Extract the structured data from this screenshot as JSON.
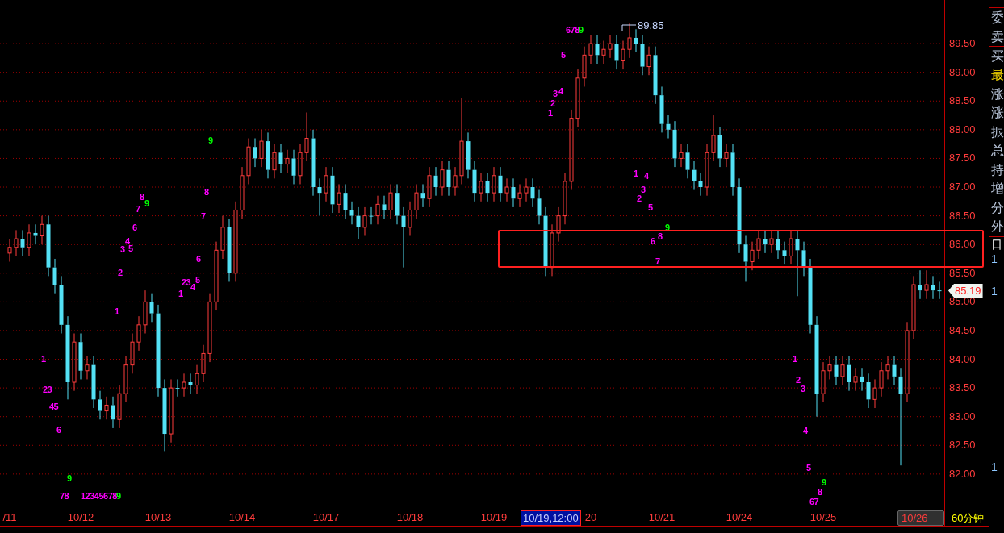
{
  "chart_data": {
    "type": "candlestick",
    "ylim": [
      81.38,
      90.26
    ],
    "grid": true,
    "categories": [
      "/11",
      null,
      null,
      null,
      null,
      null,
      null,
      null,
      null,
      null,
      null,
      "10/12",
      null,
      null,
      null,
      null,
      null,
      null,
      null,
      null,
      null,
      null,
      null,
      "10/13",
      null,
      null,
      null,
      null,
      null,
      null,
      null,
      null,
      null,
      null,
      null,
      null,
      "10/14",
      null,
      null,
      null,
      null,
      null,
      null,
      null,
      null,
      null,
      null,
      null,
      null,
      "10/17",
      null,
      null,
      null,
      null,
      null,
      null,
      null,
      null,
      null,
      null,
      null,
      null,
      "10/18",
      null,
      null,
      null,
      null,
      null,
      null,
      null,
      null,
      null,
      null,
      null,
      null,
      "10/19",
      null,
      null,
      null,
      null,
      null,
      null,
      null,
      null,
      null,
      null,
      null,
      null,
      null,
      null,
      "20",
      null,
      null,
      null,
      null,
      null,
      null,
      null,
      null,
      null,
      null,
      "10/21",
      null,
      null,
      null,
      null,
      null,
      null,
      null,
      null,
      null,
      null,
      null,
      "10/24",
      null,
      null,
      null,
      null,
      null,
      null,
      null,
      null,
      null,
      null,
      null,
      null,
      "10/25",
      null,
      null,
      null,
      null,
      null,
      null,
      null,
      null,
      null,
      null,
      null,
      null,
      null,
      null,
      null,
      null,
      null,
      null
    ],
    "yticks": [
      {
        "value": 89.5,
        "label": "89.50"
      },
      {
        "value": 89,
        "label": "89.00"
      },
      {
        "value": 88.5,
        "label": "88.50"
      },
      {
        "value": 88,
        "label": "88.00"
      },
      {
        "value": 87.5,
        "label": "87.50"
      },
      {
        "value": 87,
        "label": "87.00"
      },
      {
        "value": 86.5,
        "label": "86.50"
      },
      {
        "value": 86,
        "label": "86.00"
      },
      {
        "value": 85.5,
        "label": "85.50"
      },
      {
        "value": 85,
        "label": "85.00"
      },
      {
        "value": 84.5,
        "label": "84.50"
      },
      {
        "value": 84,
        "label": "84.00"
      },
      {
        "value": 83.5,
        "label": "83.50"
      },
      {
        "value": 83,
        "label": "83.00"
      },
      {
        "value": 82.5,
        "label": "82.50"
      },
      {
        "value": 82,
        "label": "82.00"
      }
    ],
    "ohlc": [
      [
        85.85,
        86.1,
        85.7,
        85.95
      ],
      [
        85.95,
        86.25,
        85.8,
        86.1
      ],
      [
        86.1,
        86.25,
        85.8,
        85.95
      ],
      [
        85.95,
        86.35,
        85.8,
        86.2
      ],
      [
        86.2,
        86.35,
        86.0,
        86.15
      ],
      [
        86.15,
        86.5,
        86.0,
        86.35
      ],
      [
        86.35,
        86.5,
        85.45,
        85.6
      ],
      [
        85.6,
        85.75,
        85.15,
        85.3
      ],
      [
        85.3,
        85.45,
        84.45,
        84.6
      ],
      [
        84.6,
        84.75,
        83.3,
        83.6
      ],
      [
        83.6,
        84.45,
        83.45,
        84.3
      ],
      [
        84.3,
        84.45,
        83.65,
        83.8
      ],
      [
        83.8,
        84.05,
        83.65,
        83.9
      ],
      [
        83.9,
        84.05,
        83.15,
        83.3
      ],
      [
        83.3,
        83.45,
        82.95,
        83.1
      ],
      [
        83.1,
        83.35,
        82.95,
        83.2
      ],
      [
        83.2,
        83.35,
        82.8,
        82.95
      ],
      [
        82.95,
        83.55,
        82.8,
        83.4
      ],
      [
        83.4,
        84.05,
        83.25,
        83.9
      ],
      [
        83.9,
        84.45,
        83.75,
        84.3
      ],
      [
        84.3,
        84.75,
        84.15,
        84.6
      ],
      [
        84.6,
        85.2,
        84.45,
        85.0
      ],
      [
        85.0,
        85.15,
        84.65,
        84.8
      ],
      [
        84.8,
        84.95,
        83.35,
        83.5
      ],
      [
        83.5,
        83.65,
        82.4,
        82.7
      ],
      [
        82.7,
        83.65,
        82.55,
        83.5
      ],
      [
        83.5,
        83.65,
        83.35,
        83.5
      ],
      [
        83.5,
        83.75,
        83.35,
        83.6
      ],
      [
        83.6,
        83.75,
        83.4,
        83.55
      ],
      [
        83.55,
        83.9,
        83.4,
        83.75
      ],
      [
        83.75,
        84.25,
        83.6,
        84.1
      ],
      [
        84.1,
        85.15,
        83.95,
        85.0
      ],
      [
        85.0,
        86.05,
        84.85,
        85.9
      ],
      [
        85.9,
        86.5,
        85.75,
        86.3
      ],
      [
        86.3,
        86.45,
        85.35,
        85.5
      ],
      [
        85.5,
        86.75,
        85.35,
        86.6
      ],
      [
        86.6,
        87.35,
        86.45,
        87.2
      ],
      [
        87.2,
        87.85,
        87.05,
        87.7
      ],
      [
        87.7,
        87.85,
        87.35,
        87.5
      ],
      [
        87.5,
        88.0,
        87.35,
        87.8
      ],
      [
        87.8,
        87.95,
        87.15,
        87.3
      ],
      [
        87.3,
        87.75,
        87.15,
        87.6
      ],
      [
        87.6,
        87.75,
        87.25,
        87.4
      ],
      [
        87.4,
        87.65,
        87.25,
        87.5
      ],
      [
        87.5,
        87.65,
        87.05,
        87.2
      ],
      [
        87.2,
        87.75,
        87.05,
        87.6
      ],
      [
        87.6,
        88.3,
        87.45,
        87.85
      ],
      [
        87.85,
        88.0,
        86.85,
        87.0
      ],
      [
        87.0,
        87.15,
        86.5,
        86.9
      ],
      [
        86.9,
        87.35,
        86.75,
        87.2
      ],
      [
        87.2,
        87.35,
        86.55,
        86.7
      ],
      [
        86.7,
        87.05,
        86.55,
        86.9
      ],
      [
        86.9,
        87.05,
        86.45,
        86.6
      ],
      [
        86.6,
        86.75,
        86.35,
        86.5
      ],
      [
        86.5,
        86.65,
        86.1,
        86.3
      ],
      [
        86.3,
        86.65,
        86.15,
        86.5
      ],
      [
        86.5,
        86.65,
        86.35,
        86.5
      ],
      [
        86.5,
        86.85,
        86.35,
        86.7
      ],
      [
        86.7,
        86.85,
        86.45,
        86.6
      ],
      [
        86.6,
        87.05,
        86.45,
        86.9
      ],
      [
        86.9,
        87.05,
        86.35,
        86.5
      ],
      [
        86.5,
        86.65,
        85.6,
        86.3
      ],
      [
        86.3,
        86.75,
        86.15,
        86.6
      ],
      [
        86.6,
        87.05,
        86.45,
        86.9
      ],
      [
        86.9,
        87.05,
        86.65,
        86.8
      ],
      [
        86.8,
        87.35,
        86.65,
        87.2
      ],
      [
        87.2,
        87.35,
        86.85,
        87.0
      ],
      [
        87.0,
        87.45,
        86.85,
        87.3
      ],
      [
        87.3,
        87.45,
        86.85,
        87.0
      ],
      [
        87.0,
        87.35,
        86.85,
        87.2
      ],
      [
        87.2,
        88.55,
        87.05,
        87.8
      ],
      [
        87.8,
        87.95,
        87.15,
        87.3
      ],
      [
        87.3,
        87.45,
        86.75,
        86.9
      ],
      [
        86.9,
        87.25,
        86.75,
        87.1
      ],
      [
        87.1,
        87.25,
        86.75,
        86.9
      ],
      [
        86.9,
        87.35,
        86.75,
        87.2
      ],
      [
        87.2,
        87.35,
        86.75,
        86.9
      ],
      [
        86.9,
        87.15,
        86.75,
        87.0
      ],
      [
        87.0,
        87.15,
        86.65,
        86.8
      ],
      [
        86.8,
        87.05,
        86.65,
        86.9
      ],
      [
        86.9,
        87.15,
        86.75,
        87.0
      ],
      [
        87.0,
        87.15,
        86.65,
        86.8
      ],
      [
        86.8,
        86.95,
        86.35,
        86.5
      ],
      [
        86.5,
        86.65,
        85.45,
        85.6
      ],
      [
        85.6,
        86.35,
        85.45,
        86.2
      ],
      [
        86.2,
        86.65,
        86.05,
        86.5
      ],
      [
        86.5,
        87.25,
        86.35,
        87.1
      ],
      [
        87.1,
        88.35,
        86.95,
        88.2
      ],
      [
        88.2,
        89.05,
        88.05,
        88.9
      ],
      [
        88.9,
        89.45,
        88.75,
        89.3
      ],
      [
        89.3,
        89.65,
        89.15,
        89.5
      ],
      [
        89.5,
        89.65,
        89.15,
        89.3
      ],
      [
        89.3,
        89.55,
        89.15,
        89.4
      ],
      [
        89.4,
        89.65,
        89.25,
        89.5
      ],
      [
        89.5,
        89.65,
        89.05,
        89.2
      ],
      [
        89.2,
        89.55,
        89.05,
        89.4
      ],
      [
        89.4,
        89.85,
        89.25,
        89.6
      ],
      [
        89.6,
        89.75,
        89.35,
        89.5
      ],
      [
        89.5,
        89.65,
        88.95,
        89.1
      ],
      [
        89.1,
        89.45,
        88.95,
        89.3
      ],
      [
        89.3,
        89.45,
        88.45,
        88.6
      ],
      [
        88.6,
        88.75,
        87.95,
        88.1
      ],
      [
        88.1,
        88.25,
        87.85,
        88.0
      ],
      [
        88.0,
        88.15,
        87.35,
        87.5
      ],
      [
        87.5,
        87.75,
        87.35,
        87.6
      ],
      [
        87.6,
        87.75,
        87.15,
        87.3
      ],
      [
        87.3,
        87.45,
        86.95,
        87.1
      ],
      [
        87.1,
        87.25,
        86.85,
        87.0
      ],
      [
        87.0,
        87.75,
        86.85,
        87.6
      ],
      [
        87.6,
        88.25,
        87.45,
        87.9
      ],
      [
        87.9,
        88.05,
        87.35,
        87.5
      ],
      [
        87.5,
        87.75,
        87.35,
        87.6
      ],
      [
        87.6,
        87.75,
        86.85,
        87.0
      ],
      [
        87.0,
        87.15,
        85.85,
        86.0
      ],
      [
        86.0,
        86.15,
        85.35,
        85.7
      ],
      [
        85.7,
        86.05,
        85.55,
        85.9
      ],
      [
        85.9,
        86.25,
        85.75,
        86.1
      ],
      [
        86.1,
        86.25,
        85.85,
        86.0
      ],
      [
        86.0,
        86.25,
        85.85,
        86.1
      ],
      [
        86.1,
        86.25,
        85.75,
        85.9
      ],
      [
        85.9,
        86.05,
        85.65,
        85.8
      ],
      [
        85.8,
        86.25,
        85.65,
        86.1
      ],
      [
        86.1,
        86.25,
        85.1,
        85.9
      ],
      [
        85.9,
        86.05,
        85.45,
        85.6
      ],
      [
        85.6,
        85.75,
        84.45,
        84.6
      ],
      [
        84.6,
        84.75,
        83.0,
        83.4
      ],
      [
        83.4,
        83.95,
        83.25,
        83.8
      ],
      [
        83.8,
        84.05,
        83.65,
        83.9
      ],
      [
        83.9,
        84.05,
        83.55,
        83.7
      ],
      [
        83.7,
        84.05,
        83.55,
        83.9
      ],
      [
        83.9,
        84.05,
        83.45,
        83.6
      ],
      [
        83.6,
        83.85,
        83.45,
        83.7
      ],
      [
        83.7,
        83.85,
        83.45,
        83.6
      ],
      [
        83.6,
        83.75,
        83.15,
        83.3
      ],
      [
        83.3,
        83.65,
        83.15,
        83.5
      ],
      [
        83.5,
        83.95,
        83.35,
        83.8
      ],
      [
        83.8,
        84.05,
        83.65,
        83.9
      ],
      [
        83.9,
        84.05,
        83.55,
        83.7
      ],
      [
        83.7,
        83.85,
        82.15,
        83.4
      ],
      [
        83.4,
        84.65,
        83.25,
        84.5
      ],
      [
        84.5,
        85.45,
        84.35,
        85.3
      ],
      [
        85.3,
        85.55,
        85.05,
        85.2
      ],
      [
        85.2,
        85.55,
        85.05,
        85.3
      ],
      [
        85.3,
        85.45,
        85.05,
        85.2
      ],
      [
        85.2,
        85.35,
        85.05,
        85.19
      ]
    ]
  },
  "high_label": "89.85",
  "last_price": "85.19",
  "markers": [
    {
      "label": "1",
      "color": "#ff00ff"
    },
    {
      "label": "23",
      "color": "#ff00ff"
    },
    {
      "label": "45",
      "color": "#ff00ff"
    },
    {
      "label": "6",
      "color": "#ff00ff"
    },
    {
      "label": "9",
      "color": "#00ff00"
    },
    {
      "label": "78",
      "color": "#ff00ff"
    },
    {
      "label": "12345678",
      "color": "#ff00ff"
    },
    {
      "label": "9",
      "color": "#00ff00"
    },
    {
      "label": "8",
      "color": "#ff00ff"
    },
    {
      "label": "9",
      "color": "#00ff00"
    },
    {
      "label": "7",
      "color": "#ff00ff"
    },
    {
      "label": "6",
      "color": "#ff00ff"
    },
    {
      "label": "4",
      "color": "#ff00ff"
    },
    {
      "label": "3",
      "color": "#ff00ff"
    },
    {
      "label": "5",
      "color": "#ff00ff"
    },
    {
      "label": "2",
      "color": "#ff00ff"
    },
    {
      "label": "1",
      "color": "#ff00ff"
    },
    {
      "label": "9",
      "color": "#00ff00"
    },
    {
      "label": "8",
      "color": "#ff00ff"
    },
    {
      "label": "7",
      "color": "#ff00ff"
    },
    {
      "label": "6",
      "color": "#ff00ff"
    },
    {
      "label": "23",
      "color": "#ff00ff"
    },
    {
      "label": "4",
      "color": "#ff00ff"
    },
    {
      "label": "5",
      "color": "#ff00ff"
    },
    {
      "label": "1",
      "color": "#ff00ff"
    },
    {
      "label": "678",
      "color": "#ff00ff"
    },
    {
      "label": "9",
      "color": "#00ff00"
    },
    {
      "label": "5",
      "color": "#ff00ff"
    },
    {
      "label": "3",
      "color": "#ff00ff"
    },
    {
      "label": "4",
      "color": "#ff00ff"
    },
    {
      "label": "2",
      "color": "#ff00ff"
    },
    {
      "label": "1",
      "color": "#ff00ff"
    },
    {
      "label": "1",
      "color": "#ff00ff"
    },
    {
      "label": "4",
      "color": "#ff00ff"
    },
    {
      "label": "3",
      "color": "#ff00ff"
    },
    {
      "label": "2",
      "color": "#ff00ff"
    },
    {
      "label": "5",
      "color": "#ff00ff"
    },
    {
      "label": "9",
      "color": "#00ff00"
    },
    {
      "label": "8",
      "color": "#ff00ff"
    },
    {
      "label": "6",
      "color": "#ff00ff"
    },
    {
      "label": "7",
      "color": "#ff00ff"
    },
    {
      "label": "1",
      "color": "#ff00ff"
    },
    {
      "label": "2",
      "color": "#ff00ff"
    },
    {
      "label": "3",
      "color": "#ff00ff"
    },
    {
      "label": "4",
      "color": "#ff00ff"
    },
    {
      "label": "5",
      "color": "#ff00ff"
    },
    {
      "label": "9",
      "color": "#00ff00"
    },
    {
      "label": "8",
      "color": "#ff00ff"
    },
    {
      "label": "67",
      "color": "#ff00ff"
    }
  ],
  "date_axis": [
    {
      "label": "10/19,12:00",
      "kind": "cursor"
    },
    {
      "label": "10/26",
      "kind": "current"
    }
  ],
  "period": "60分钟",
  "side_panel": [
    {
      "label": "委",
      "kind": "boxed",
      "color": "#b8c4d8"
    },
    {
      "label": "卖",
      "kind": "boxed",
      "color": "#b8c4d8"
    },
    {
      "label": "买",
      "kind": "boxed",
      "color": "#b8c4d8"
    },
    {
      "label": "最",
      "kind": "plain",
      "color": "#ffe000"
    },
    {
      "label": "涨",
      "kind": "plain",
      "color": "#b8c4d8"
    },
    {
      "label": "涨",
      "kind": "plain",
      "color": "#b8c4d8"
    },
    {
      "label": "振",
      "kind": "plain",
      "color": "#b8c4d8"
    },
    {
      "label": "总",
      "kind": "plain",
      "color": "#b8c4d8"
    },
    {
      "label": "持",
      "kind": "plain",
      "color": "#b8c4d8"
    },
    {
      "label": "增",
      "kind": "plain",
      "color": "#b8c4d8"
    },
    {
      "label": "分",
      "kind": "plain",
      "color": "#b8c4d8"
    },
    {
      "label": "外",
      "kind": "plain",
      "color": "#b8c4d8"
    },
    {
      "label": "日",
      "kind": "header",
      "color": "#ffffff"
    },
    {
      "label": "1",
      "kind": "value",
      "color": "#8fc8ff"
    },
    {
      "label": "1",
      "kind": "value",
      "color": "#8fc8ff"
    },
    {
      "label": "1",
      "kind": "value",
      "color": "#8fc8ff"
    }
  ]
}
